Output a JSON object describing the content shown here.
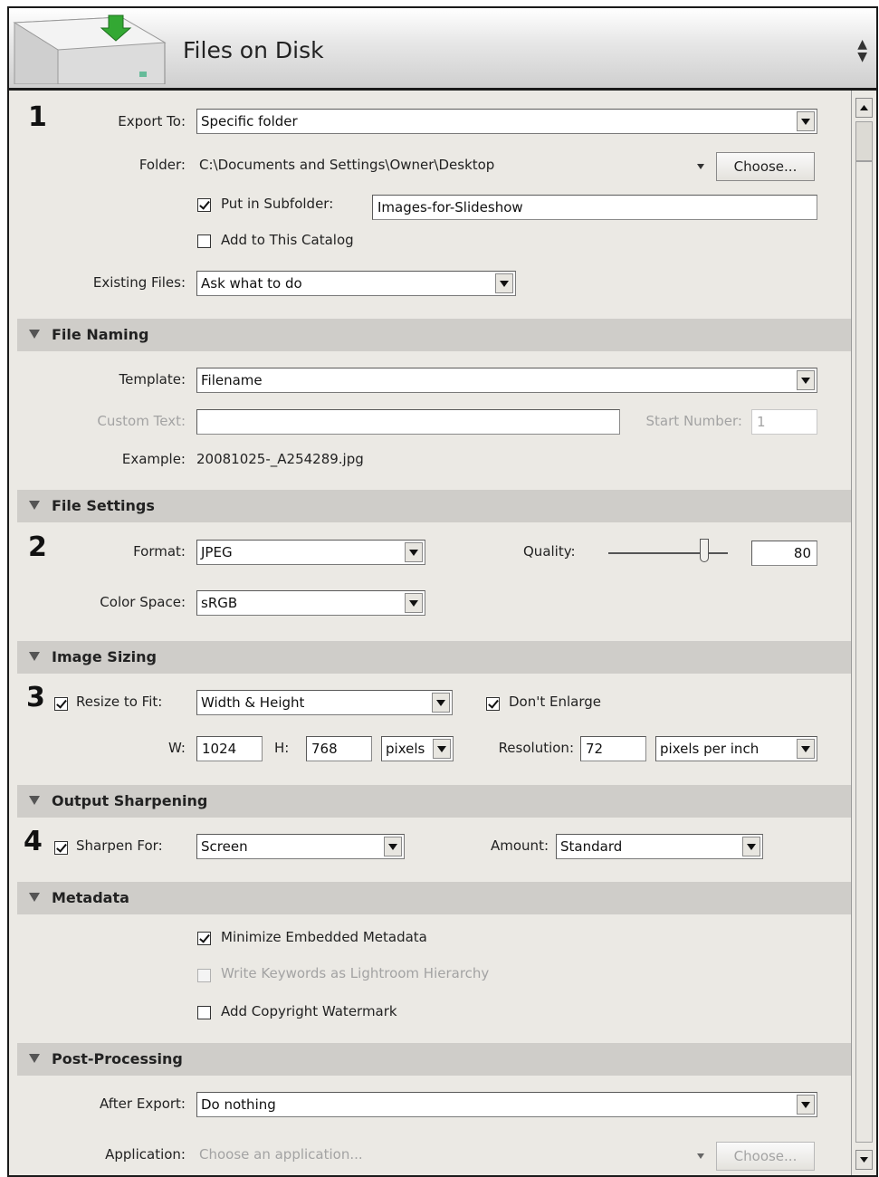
{
  "header": {
    "title": "Files on Disk"
  },
  "steps": [
    "1",
    "2",
    "3",
    "4"
  ],
  "export_location": {
    "export_to_label": "Export To:",
    "export_to_value": "Specific folder",
    "folder_label": "Folder:",
    "folder_path": "C:\\Documents and Settings\\Owner\\Desktop",
    "choose_button": "Choose...",
    "put_in_subfolder_label": "Put in Subfolder:",
    "put_in_subfolder_checked": true,
    "subfolder_value": "Images-for-Slideshow",
    "add_to_catalog_label": "Add to This Catalog",
    "add_to_catalog_checked": false,
    "existing_files_label": "Existing Files:",
    "existing_files_value": "Ask what to do"
  },
  "file_naming": {
    "section_label": "File Naming",
    "template_label": "Template:",
    "template_value": "Filename",
    "custom_text_label": "Custom Text:",
    "custom_text_value": "",
    "start_number_label": "Start Number:",
    "start_number_value": "1",
    "example_label": "Example:",
    "example_value": "20081025-_A254289.jpg"
  },
  "file_settings": {
    "section_label": "File Settings",
    "format_label": "Format:",
    "format_value": "JPEG",
    "quality_label": "Quality:",
    "quality_value": "80",
    "color_space_label": "Color Space:",
    "color_space_value": "sRGB"
  },
  "image_sizing": {
    "section_label": "Image Sizing",
    "resize_label": "Resize to Fit:",
    "resize_checked": true,
    "resize_value": "Width & Height",
    "dont_enlarge_label": "Don't Enlarge",
    "dont_enlarge_checked": true,
    "w_label": "W:",
    "w_value": "1024",
    "h_label": "H:",
    "h_value": "768",
    "unit_value": "pixels",
    "resolution_label": "Resolution:",
    "resolution_value": "72",
    "resolution_unit_value": "pixels per inch"
  },
  "output_sharpening": {
    "section_label": "Output Sharpening",
    "sharpen_label": "Sharpen For:",
    "sharpen_checked": true,
    "sharpen_value": "Screen",
    "amount_label": "Amount:",
    "amount_value": "Standard"
  },
  "metadata": {
    "section_label": "Metadata",
    "minimize_label": "Minimize Embedded Metadata",
    "minimize_checked": true,
    "write_keywords_label": "Write Keywords as Lightroom Hierarchy",
    "write_keywords_checked": false,
    "copyright_label": "Add Copyright Watermark",
    "copyright_checked": false
  },
  "post_processing": {
    "section_label": "Post-Processing",
    "after_export_label": "After Export:",
    "after_export_value": "Do nothing",
    "application_label": "Application:",
    "application_placeholder": "Choose an application...",
    "choose_button": "Choose..."
  },
  "icons": {
    "header_icon": "drive-export-icon",
    "header_updown": "updown-arrows-icon",
    "section_triangle": "disclosure-triangle-icon"
  }
}
